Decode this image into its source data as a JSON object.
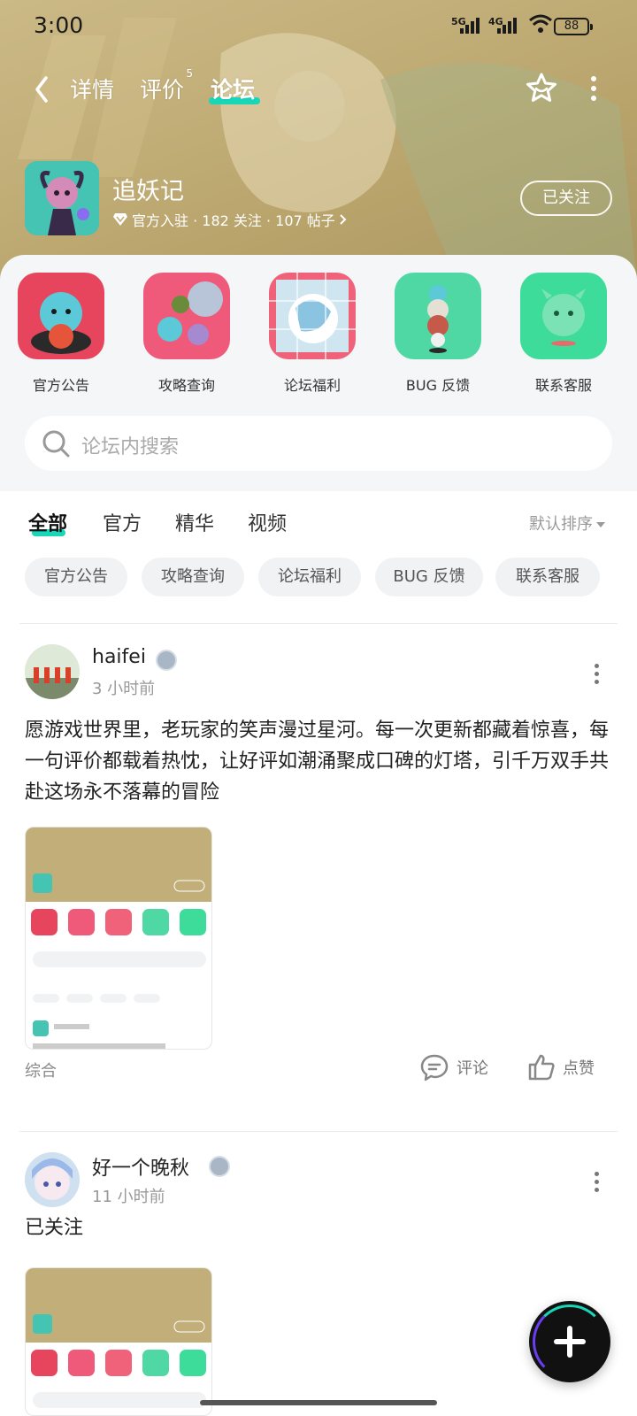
{
  "status_bar": {
    "time": "3:00",
    "net1": "5G",
    "net2": "4G",
    "battery": "88"
  },
  "nav": {
    "tabs": [
      {
        "label": "详情"
      },
      {
        "label": "评价",
        "count": "5"
      },
      {
        "label": "论坛"
      }
    ],
    "active_tab": "论坛"
  },
  "game": {
    "name": "追妖记",
    "meta": "官方入驻 · 182 关注 · 107 帖子",
    "follow_label": "已关注"
  },
  "shortcuts": [
    {
      "label": "官方公告"
    },
    {
      "label": "攻略查询"
    },
    {
      "label": "论坛福利"
    },
    {
      "label": "BUG 反馈"
    },
    {
      "label": "联系客服"
    }
  ],
  "search": {
    "placeholder": "论坛内搜索"
  },
  "filter_tabs": [
    {
      "label": "全部"
    },
    {
      "label": "官方"
    },
    {
      "label": "精华"
    },
    {
      "label": "视频"
    }
  ],
  "sort_label": "默认排序",
  "chips": [
    {
      "label": "官方公告"
    },
    {
      "label": "攻略查询"
    },
    {
      "label": "论坛福利"
    },
    {
      "label": "BUG 反馈"
    },
    {
      "label": "联系客服"
    }
  ],
  "posts": [
    {
      "author": "haifei",
      "time": "3 小时前",
      "text": "愿游戏世界里，老玩家的笑声漫过星河。每一次更新都藏着惊喜，每一句评价都载着热忱，让好评如潮涌聚成口碑的灯塔，引千万双手共赴这场永不落幕的冒险",
      "category": "综合",
      "comment_label": "评论",
      "like_label": "点赞"
    },
    {
      "author": "好一个晚秋",
      "time": "11 小时前",
      "text": "已关注"
    }
  ],
  "colors": {
    "accent": "#18d6b8",
    "header_bg": "#c2ae78"
  }
}
